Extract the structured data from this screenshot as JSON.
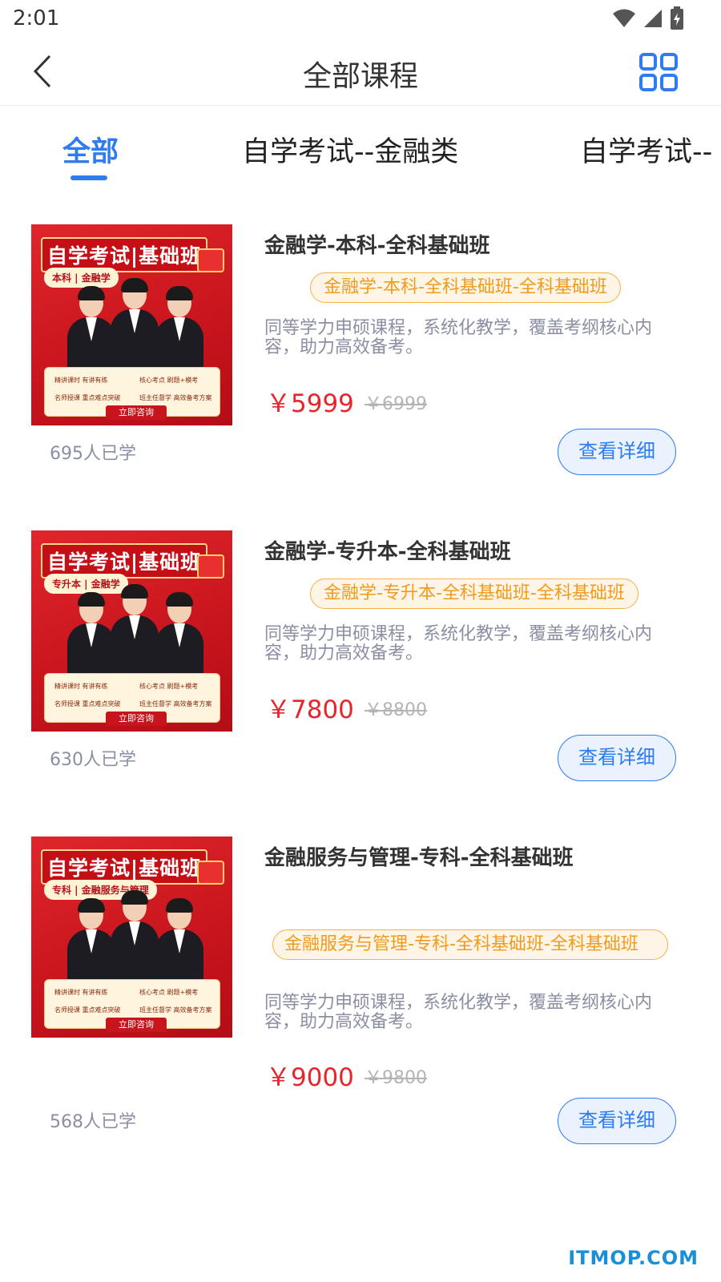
{
  "status_bar": {
    "time": "2:01",
    "icons": [
      "wifi-icon",
      "signal-icon",
      "battery-icon"
    ]
  },
  "nav": {
    "title": "全部课程",
    "back_icon": "chevron-left-icon",
    "menu_icon": "grid-icon"
  },
  "tabs": [
    {
      "label": "全部",
      "active": true
    },
    {
      "label": "自学考试--金融类",
      "active": false
    },
    {
      "label": "自学考试--",
      "active": false
    }
  ],
  "courses": [
    {
      "cover": {
        "banner": "自学考试|基础班",
        "sub": "本科 | 金融学",
        "features": [
          "精讲课时 有讲有练",
          "核心考点 刷题+模考",
          "名师授课 重点难点突破",
          "班主任督学 高效备考方案"
        ],
        "button": "立即咨询"
      },
      "title": "金融学-本科-全科基础班",
      "tag": "金融学-本科-全科基础班-全科基础班",
      "desc": "同等学力申硕课程，系统化教学，覆盖考纲核心内容，助力高效备考。",
      "price": "￥5999",
      "orig_price": "￥6999",
      "learners": "695人已学",
      "detail_label": "查看详细"
    },
    {
      "cover": {
        "banner": "自学考试|基础班",
        "sub": "专升本 | 金融学",
        "features": [
          "精讲课时 有讲有练",
          "核心考点 刷题+模考",
          "名师授课 重点难点突破",
          "班主任督学 高效备考方案"
        ],
        "button": "立即咨询"
      },
      "title": "金融学-专升本-全科基础班",
      "tag": "金融学-专升本-全科基础班-全科基础班",
      "desc": "同等学力申硕课程，系统化教学，覆盖考纲核心内容，助力高效备考。",
      "price": "￥7800",
      "orig_price": "￥8800",
      "learners": "630人已学",
      "detail_label": "查看详细"
    },
    {
      "cover": {
        "banner": "自学考试|基础班",
        "sub": "专科 | 金融服务与管理",
        "features": [
          "精讲课时 有讲有练",
          "核心考点 刷题+模考",
          "名师授课 重点难点突破",
          "班主任督学 高效备考方案"
        ],
        "button": "立即咨询"
      },
      "title": "金融服务与管理-专科-全科基础班",
      "tag": "金融服务与管理-专科-全科基础班-全科基础班",
      "desc": "同等学力申硕课程，系统化教学，覆盖考纲核心内容，助力高效备考。",
      "price": "￥9000",
      "orig_price": "￥9800",
      "learners": "568人已学",
      "detail_label": "查看详细"
    }
  ],
  "colors": {
    "accent": "#2f7bf0",
    "price": "#e8252b",
    "tag_text": "#f19b1d",
    "muted": "#8a8fa3"
  },
  "watermark": "ITMOP.COM"
}
